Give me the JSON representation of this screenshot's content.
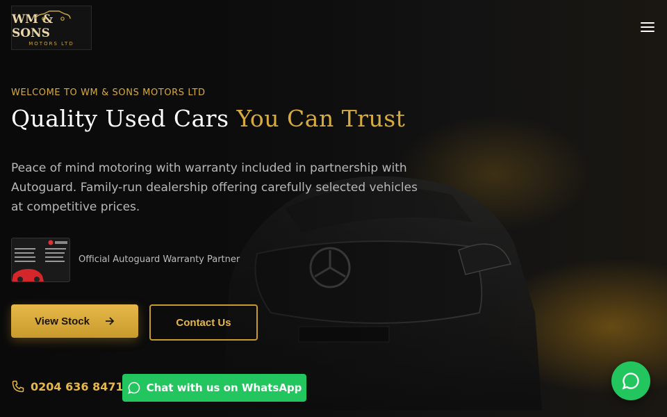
{
  "brand": {
    "name": "WM & SONS",
    "subtitle": "MOTORS LTD"
  },
  "hero": {
    "eyebrow": "WELCOME TO WM & SONS MOTORS LTD",
    "headline_main": "Quality Used Cars",
    "headline_accent": "You Can Trust",
    "description": "Peace of mind motoring with warranty included in partnership with Autoguard. Family-run dealership offering carefully selected vehicles at competitive prices."
  },
  "partner": {
    "text": "Official Autoguard Warranty Partner"
  },
  "buttons": {
    "view_stock": "View Stock",
    "contact": "Contact Us"
  },
  "contact": {
    "phone": "0204 636 8471",
    "whatsapp_label": "Chat with us on WhatsApp"
  },
  "colors": {
    "accent": "#d7ab3f",
    "whatsapp": "#22c55e",
    "background": "#0b0b0b"
  },
  "icons": [
    "menu-icon",
    "arrow-right-icon",
    "phone-icon",
    "whatsapp-icon"
  ]
}
